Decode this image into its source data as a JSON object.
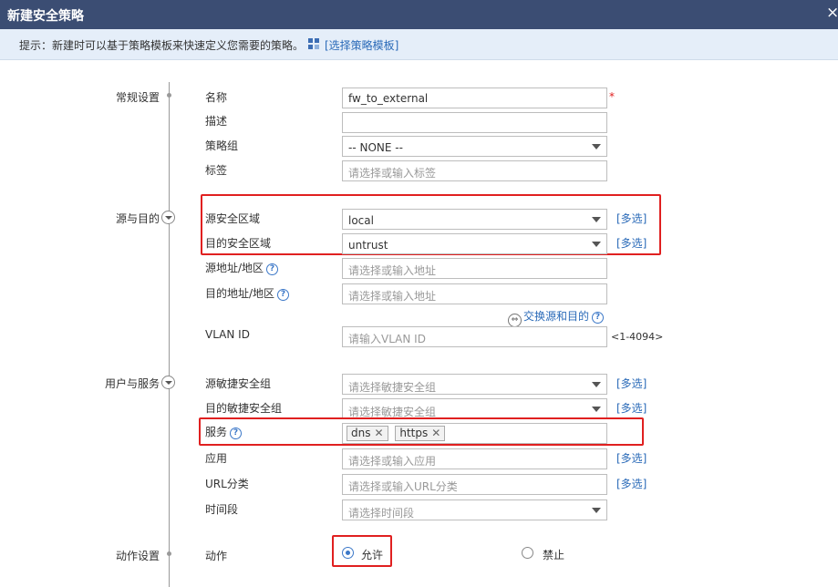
{
  "window": {
    "title": "新建安全策略",
    "close": "×"
  },
  "tip": {
    "text": "提示：新建时可以基于策略模板来快速定义您需要的策略。",
    "link": "[选择策略模板]"
  },
  "sections": {
    "general": "常规设置",
    "source_dest": "源与目的",
    "user_service": "用户与服务",
    "action": "动作设置"
  },
  "fields": {
    "name": {
      "label": "名称",
      "value": "fw_to_external",
      "required": "*"
    },
    "description": {
      "label": "描述",
      "value": ""
    },
    "policy_group": {
      "label": "策略组",
      "value": "-- NONE --"
    },
    "tag": {
      "label": "标签",
      "placeholder": "请选择或输入标签"
    },
    "src_zone": {
      "label": "源安全区域",
      "value": "local"
    },
    "dst_zone": {
      "label": "目的安全区域",
      "value": "untrust"
    },
    "src_addr": {
      "label": "源地址/地区",
      "placeholder": "请选择或输入地址"
    },
    "dst_addr": {
      "label": "目的地址/地区",
      "placeholder": "请选择或输入地址"
    },
    "swap": "交换源和目的",
    "vlan": {
      "label": "VLAN ID",
      "placeholder": "请输入VLAN ID",
      "range": "<1-4094>"
    },
    "src_agile": {
      "label": "源敏捷安全组",
      "placeholder": "请选择敏捷安全组"
    },
    "dst_agile": {
      "label": "目的敏捷安全组",
      "placeholder": "请选择敏捷安全组"
    },
    "service": {
      "label": "服务",
      "tags": [
        "dns",
        "https"
      ]
    },
    "application": {
      "label": "应用",
      "placeholder": "请选择或输入应用"
    },
    "url_category": {
      "label": "URL分类",
      "placeholder": "请选择或输入URL分类"
    },
    "time_range": {
      "label": "时间段",
      "placeholder": "请选择时间段"
    },
    "action": {
      "label": "动作",
      "permit": "允许",
      "deny": "禁止",
      "selected": "permit"
    }
  },
  "multi_select_label": "[多选]",
  "colors": {
    "titlebar": "#3b4d73",
    "tipbar": "#e5eef9",
    "link": "#2a6ab8",
    "highlight": "#e02020"
  },
  "icons": {
    "help": "question-circle-icon",
    "tip": "template-icon",
    "swap": "swap-icon",
    "expand": "chevron-down-circle-icon"
  }
}
